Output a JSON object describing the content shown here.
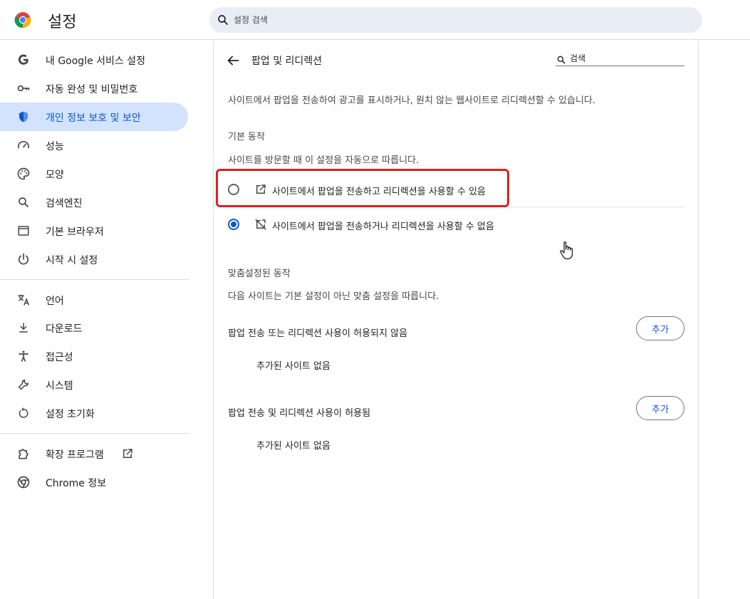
{
  "app": {
    "title": "설정"
  },
  "search": {
    "placeholder": "설정 검색"
  },
  "sidebar": {
    "items": [
      {
        "label": "내 Google 서비스 설정",
        "icon": "google-icon"
      },
      {
        "label": "자동 완성 및 비밀번호",
        "icon": "key-icon"
      },
      {
        "label": "개인 정보 보호 및 보안",
        "icon": "shield-icon",
        "active": true
      },
      {
        "label": "성능",
        "icon": "speedometer-icon"
      },
      {
        "label": "모양",
        "icon": "palette-icon"
      },
      {
        "label": "검색엔진",
        "icon": "search-icon"
      },
      {
        "label": "기본 브라우저",
        "icon": "browser-window-icon"
      },
      {
        "label": "시작 시 설정",
        "icon": "power-icon"
      },
      {
        "label": "언어",
        "icon": "translate-icon"
      },
      {
        "label": "다운로드",
        "icon": "download-icon"
      },
      {
        "label": "접근성",
        "icon": "accessibility-icon"
      },
      {
        "label": "시스템",
        "icon": "wrench-icon"
      },
      {
        "label": "설정 초기화",
        "icon": "reset-icon"
      },
      {
        "label": "확장 프로그램",
        "icon": "puzzle-icon"
      },
      {
        "label": "Chrome 정보",
        "icon": "chrome-icon"
      }
    ]
  },
  "main": {
    "title": "팝업 및 리디렉션",
    "search_placeholder": "검색",
    "description": "사이트에서 팝업을 전송하여 광고를 표시하거나, 원치 않는 웹사이트로 리디렉션할 수 있습니다.",
    "default_behavior": {
      "heading": "기본 동작",
      "subtext": "사이트를 방문할 때 이 설정을 자동으로 따릅니다.",
      "options": [
        {
          "label": "사이트에서 팝업을 전송하고 리디렉션을 사용할 수 있음",
          "selected": false,
          "icon": "open-in-new-icon"
        },
        {
          "label": "사이트에서 팝업을 전송하거나 리디렉션을 사용할 수 없음",
          "selected": true,
          "icon": "popup-blocked-icon"
        }
      ]
    },
    "custom_behavior": {
      "heading": "맞춤설정된 동작",
      "subtext": "다음 사이트는 기본 설정이 아닌 맞춤 설정을 따릅니다.",
      "blocked": {
        "label": "팝업 전송 또는 리디렉션 사용이 허용되지 않음",
        "add_label": "추가",
        "empty": "추가된 사이트 없음"
      },
      "allowed": {
        "label": "팝업 전송 및 리디렉션 사용이 허용됨",
        "add_label": "추가",
        "empty": "추가된 사이트 없음"
      }
    }
  },
  "colors": {
    "accent": "#0b57d0",
    "active_nav_bg": "#d3e3fd",
    "highlight": "#e0201b",
    "search_bg": "#e9eef6"
  }
}
